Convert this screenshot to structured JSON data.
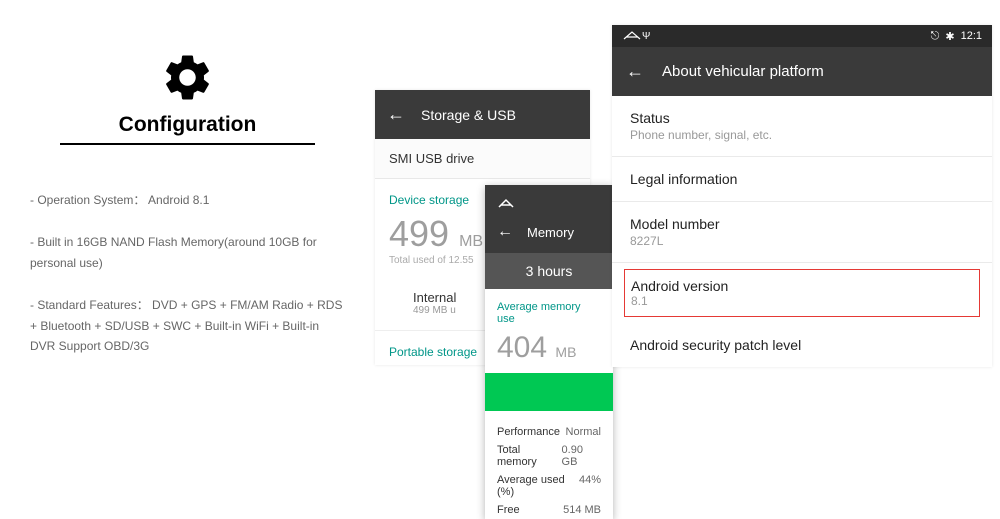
{
  "config": {
    "title": "Configuration",
    "items": [
      "- Operation System： Android 8.1",
      "- Built in 16GB NAND Flash Memory(around 10GB for personal use)",
      "- Standard Features： DVD + GPS + FM/AM Radio + RDS + Bluetooth + SD/USB + SWC + Built-in WiFi + Built-in DVR Support OBD/3G"
    ]
  },
  "storage": {
    "header": "Storage & USB",
    "usb_drive": "SMI USB drive",
    "section": "Device storage",
    "used_value": "499",
    "used_unit": "MB",
    "used_sub": "Total used of 12.55",
    "internal_label": "Internal",
    "internal_sub": "499 MB u",
    "portable": "Portable storage"
  },
  "memory": {
    "header": "Memory",
    "hours": "3 hours",
    "avg_label": "Average memory use",
    "value": "404",
    "unit": "MB",
    "rows": [
      {
        "label": "Performance",
        "value": "Normal"
      },
      {
        "label": "Total memory",
        "value": "0.90 GB"
      },
      {
        "label": "Average used (%)",
        "value": "44%"
      },
      {
        "label": "Free",
        "value": "514 MB"
      }
    ]
  },
  "about": {
    "time": "12:1",
    "header": "About vehicular platform",
    "status_title": "Status",
    "status_sub": "Phone number, signal, etc.",
    "legal": "Legal information",
    "model_title": "Model number",
    "model_value": "8227L",
    "android_title": "Android version",
    "android_value": "8.1",
    "patch": "Android security patch level"
  },
  "icons": {
    "usb_glyph": "Ψ",
    "location": "📍",
    "bt": "✱"
  }
}
